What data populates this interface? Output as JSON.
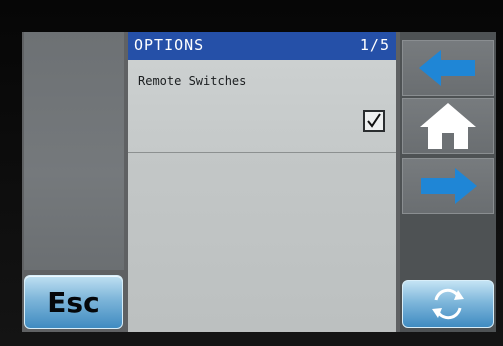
{
  "header": {
    "title": "OPTIONS",
    "page_indicator": "1/5"
  },
  "options": [
    {
      "label": "Remote Switches",
      "checked": true
    }
  ],
  "buttons": {
    "esc_label": "Esc",
    "back_icon": "arrow-left-icon",
    "home_icon": "home-icon",
    "forward_icon": "arrow-right-icon",
    "refresh_icon": "refresh-icon"
  },
  "colors": {
    "header_bg": "#2550a8",
    "accent_blue": "#3f8bc1",
    "panel_gray": "#c5c9c9"
  }
}
